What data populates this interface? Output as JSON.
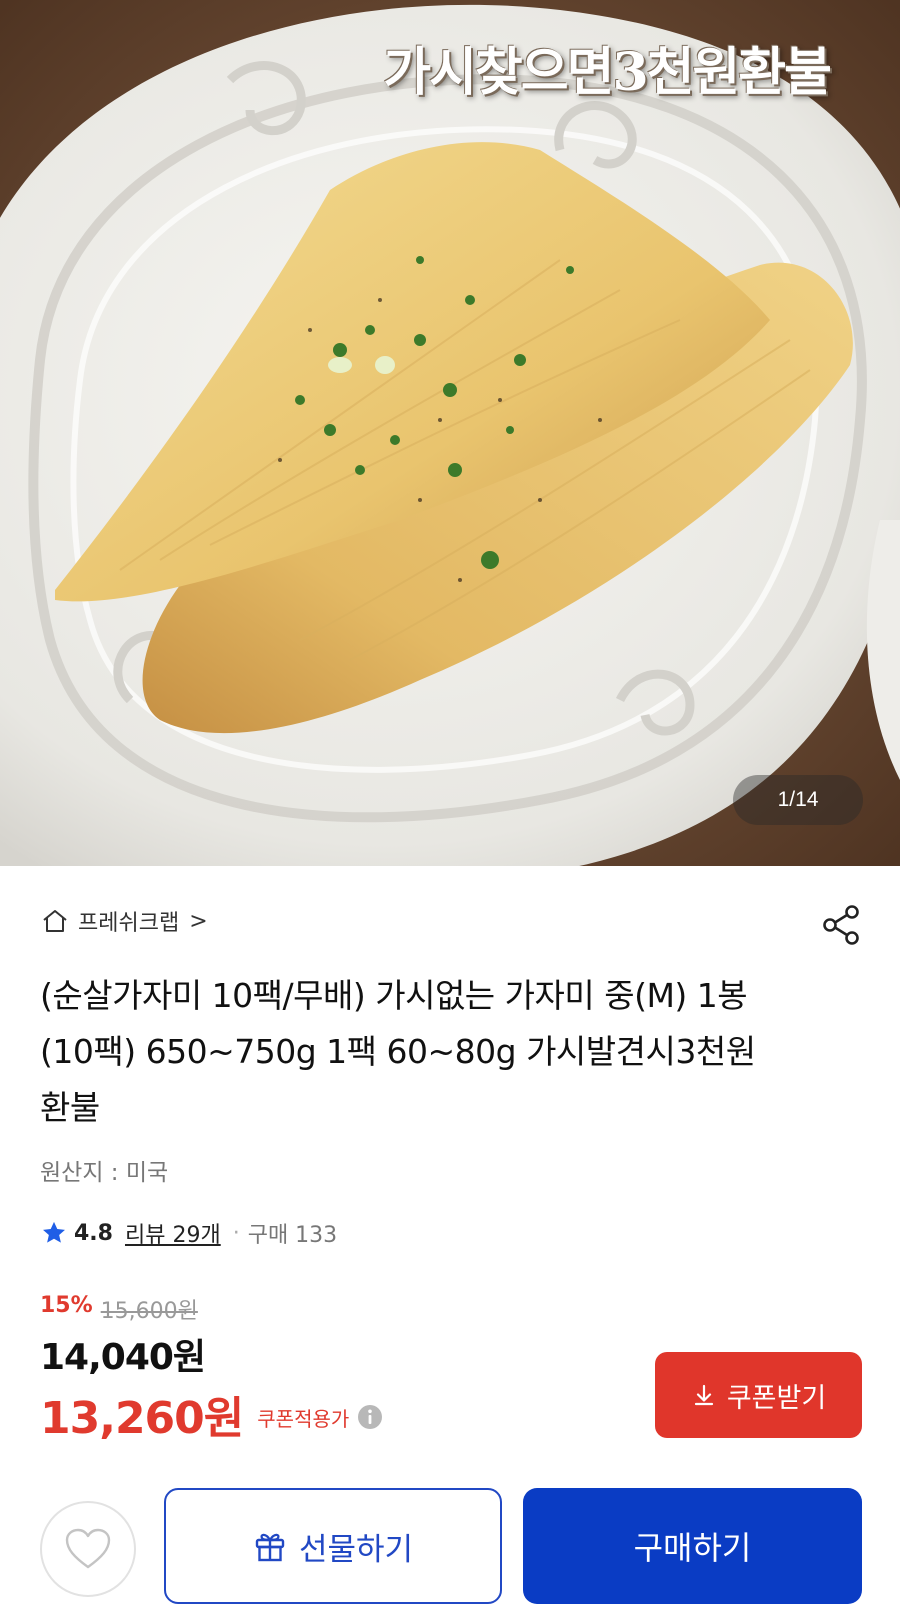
{
  "hero": {
    "overlay_text": "가시찾으면3천원환불",
    "page_indicator": "1/14"
  },
  "store": {
    "name": "프레쉬크랩",
    "chevron": ">"
  },
  "product": {
    "title": "(순살가자미 10팩/무배) 가시없는 가자미 중(M) 1봉(10팩) 650~750g 1팩 60~80g 가시발견시3천원환불",
    "origin": "원산지 : 미국"
  },
  "rating": {
    "value": "4.8",
    "review_label": "리뷰 29개",
    "separator": "·",
    "purchase_label": "구매 133"
  },
  "price": {
    "discount_rate": "15%",
    "original_price": "15,600원",
    "sale_price": "14,040원",
    "coupon_price": "13,260원",
    "coupon_note": "쿠폰적용가"
  },
  "buttons": {
    "coupon": "쿠폰받기",
    "gift": "선물하기",
    "buy": "구매하기"
  },
  "colors": {
    "accent_red": "#e0362b",
    "brand_blue": "#0a3cc4",
    "rating_star": "#1f5ee6"
  }
}
